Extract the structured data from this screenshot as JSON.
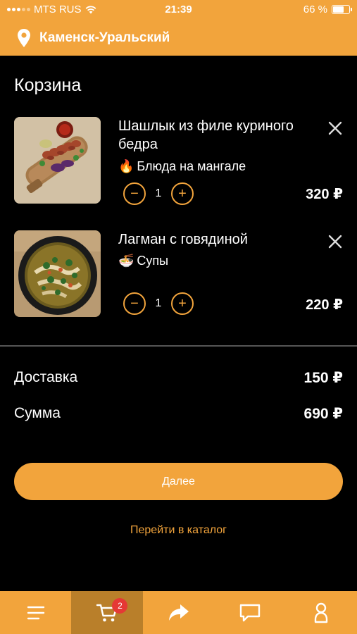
{
  "status_bar": {
    "carrier": "MTS RUS",
    "time": "21:39",
    "battery": "66 %",
    "battery_level": 0.66
  },
  "header": {
    "city": "Каменск-Уральский",
    "icon": "location-pin-icon"
  },
  "page": {
    "title": "Корзина"
  },
  "cart": {
    "items": [
      {
        "name": "Шашлык из филе куриного бедра",
        "category_emoji": "🔥",
        "category": "Блюда на мангале",
        "quantity": "1",
        "price": "320 ₽",
        "minus": "−",
        "plus": "+"
      },
      {
        "name": "Лагман с говядиной",
        "category_emoji": "🍜",
        "category": "Супы",
        "quantity": "1",
        "price": "220 ₽",
        "minus": "−",
        "plus": "+"
      }
    ]
  },
  "summary": {
    "delivery_label": "Доставка",
    "delivery_value": "150 ₽",
    "total_label": "Сумма",
    "total_value": "690 ₽"
  },
  "actions": {
    "next_label": "Далее",
    "catalog_link": "Перейти в каталог"
  },
  "bottom_nav": {
    "items": [
      "menu-icon",
      "cart-icon",
      "share-arrow-icon",
      "chat-icon",
      "profile-icon"
    ],
    "active": "cart-icon",
    "cart_badge": "2"
  },
  "colors": {
    "accent": "#f2a43c",
    "accent_active": "#b97f2a",
    "background": "#000000",
    "badge": "#e53935"
  }
}
